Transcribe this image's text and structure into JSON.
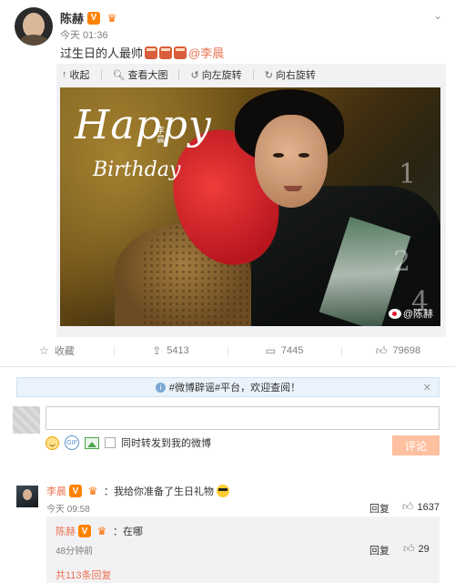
{
  "post": {
    "author": "陈赫",
    "time": "今天 01:36",
    "text_before": "过生日的人最帅",
    "mention": "@李晨",
    "more_icon": "chevron-down-icon"
  },
  "media_toolbar": {
    "collapse": "收起",
    "view_large": "查看大图",
    "rotate_left": "向左旋转",
    "rotate_right": "向右旋转"
  },
  "photo": {
    "happy": "Happy",
    "birthday": "Birthday",
    "name_vertical": "李晨",
    "watermark": "@陈赫",
    "numbers": [
      "1",
      "2",
      "4"
    ]
  },
  "actions": {
    "favorite": "收藏",
    "forward": "5413",
    "comment": "7445",
    "like": "79698"
  },
  "notice": {
    "text": "#微博辟谣#平台，欢迎查阅！"
  },
  "compose": {
    "input_value": "",
    "forward_label": "同时转发到我的微博",
    "submit": "评论"
  },
  "comments": [
    {
      "user": "李晨",
      "text": "：我给你准备了生日礼物",
      "time": "今天 09:58",
      "reply": "回复",
      "likes": "1637"
    }
  ],
  "sub_comment": {
    "user": "陈赫",
    "text": "：在哪",
    "time": "48分钟前",
    "reply": "回复",
    "likes": "29",
    "more": "共113条回复"
  },
  "colors": {
    "accent": "#eb7350",
    "submit_disabled": "#ffc09f",
    "notice_bg": "#eaf3fb"
  }
}
